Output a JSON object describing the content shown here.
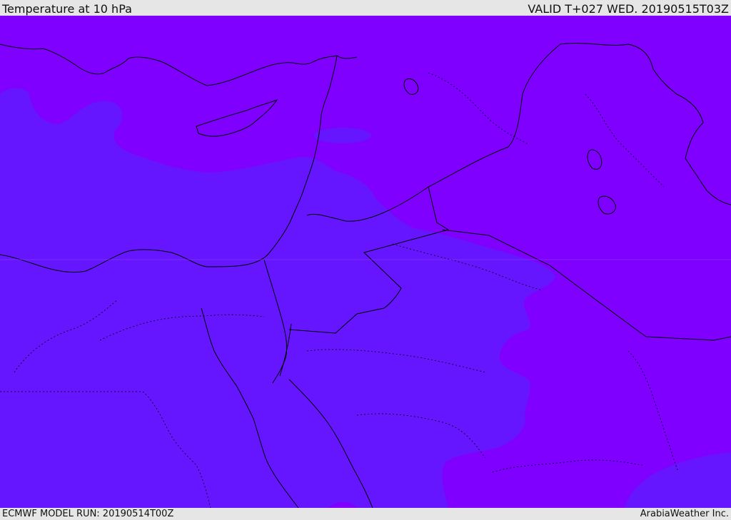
{
  "header": {
    "title": "Temperature at 10 hPa",
    "valid": "VALID T+027 WED. 20190515T03Z"
  },
  "footer": {
    "model_run": "ECMWF MODEL RUN: 20190514T00Z",
    "credit": "ArabiaWeather Inc."
  },
  "colors": {
    "warm_band": "#7f00ff",
    "cool_band": "#6616ff",
    "coast": "#000000",
    "frame": "#e6e6e6"
  }
}
